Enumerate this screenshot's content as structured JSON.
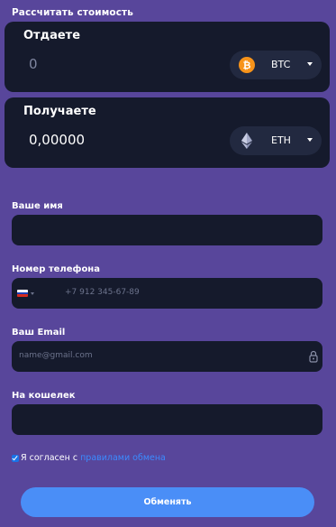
{
  "calculator": {
    "title": "Рассчитать стоимость",
    "give": {
      "label": "Отдаете",
      "amount": "0",
      "currency": "BTC",
      "currency_icon": "bitcoin-icon",
      "currency_color": "#f7931a"
    },
    "get": {
      "label": "Получаете",
      "amount": "0,00000",
      "currency": "ETH",
      "currency_icon": "ethereum-icon",
      "currency_color": "#8c93b6"
    }
  },
  "form": {
    "name": {
      "label": "Ваше имя",
      "value": "",
      "placeholder": ""
    },
    "phone": {
      "label": "Номер телефона",
      "value": "",
      "placeholder": "+7 912 345-67-89",
      "flag_icon": "russia-flag-icon"
    },
    "email": {
      "label": "Ваш Email",
      "value": "",
      "placeholder": "name@gmail.com"
    },
    "wallet": {
      "label": "На кошелек",
      "value": "",
      "placeholder": ""
    }
  },
  "agreement": {
    "checked": true,
    "text": "Я согласен с",
    "link_text": "правилами обмена"
  },
  "submit": {
    "label": "Обменять"
  },
  "colors": {
    "background": "#58469b",
    "card": "#151a2c",
    "accent": "#4a8ef7",
    "link": "#3b8bff"
  }
}
